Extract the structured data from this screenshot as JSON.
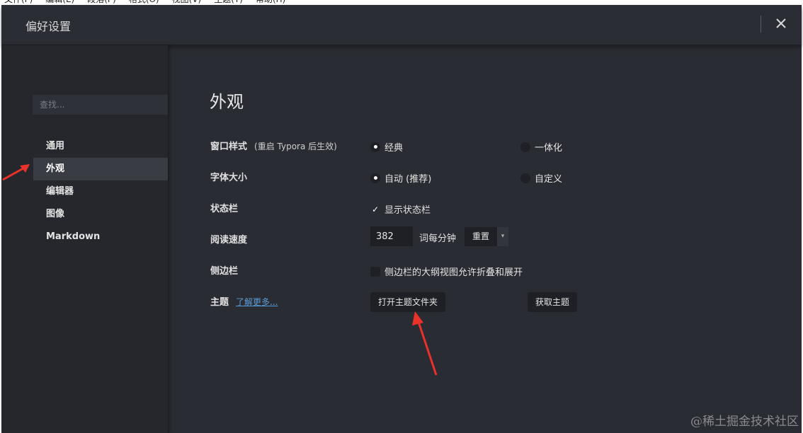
{
  "menubar": {
    "items": [
      "文件(F)",
      "编辑(E)",
      "段落(P)",
      "格式(O)",
      "视图(V)",
      "主题(T)",
      "帮助(H)"
    ]
  },
  "window": {
    "title": "偏好设置",
    "close_icon": "close-icon"
  },
  "sidebar": {
    "search_placeholder": "查找...",
    "items": [
      {
        "label": "通用",
        "active": false
      },
      {
        "label": "外观",
        "active": true
      },
      {
        "label": "编辑器",
        "active": false
      },
      {
        "label": "图像",
        "active": false
      },
      {
        "label": "Markdown",
        "active": false
      }
    ]
  },
  "main": {
    "heading": "外观",
    "window_style": {
      "label": "窗口样式",
      "note": "(重启 Typora 后生效)",
      "options": [
        {
          "label": "经典",
          "checked": true
        },
        {
          "label": "一体化",
          "checked": false
        }
      ]
    },
    "font_size": {
      "label": "字体大小",
      "options": [
        {
          "label": "自动 (推荐)",
          "checked": true
        },
        {
          "label": "自定义",
          "checked": false
        }
      ]
    },
    "status_bar": {
      "label": "状态栏",
      "checkbox_label": "显示状态栏",
      "checked": true
    },
    "reading_speed": {
      "label": "阅读速度",
      "value": "382",
      "unit": "词每分钟",
      "reset_label": "重置",
      "caret": "▾"
    },
    "sidebar_setting": {
      "label": "侧边栏",
      "checkbox_label": "侧边栏的大纲视图允许折叠和展开",
      "checked": false
    },
    "theme": {
      "label": "主题",
      "link": "了解更多...",
      "open_folder_label": "打开主题文件夹",
      "get_themes_label": "获取主题"
    }
  },
  "annotations": {
    "arrow_color": "#e8322a"
  },
  "watermark": "@稀土掘金技术社区"
}
